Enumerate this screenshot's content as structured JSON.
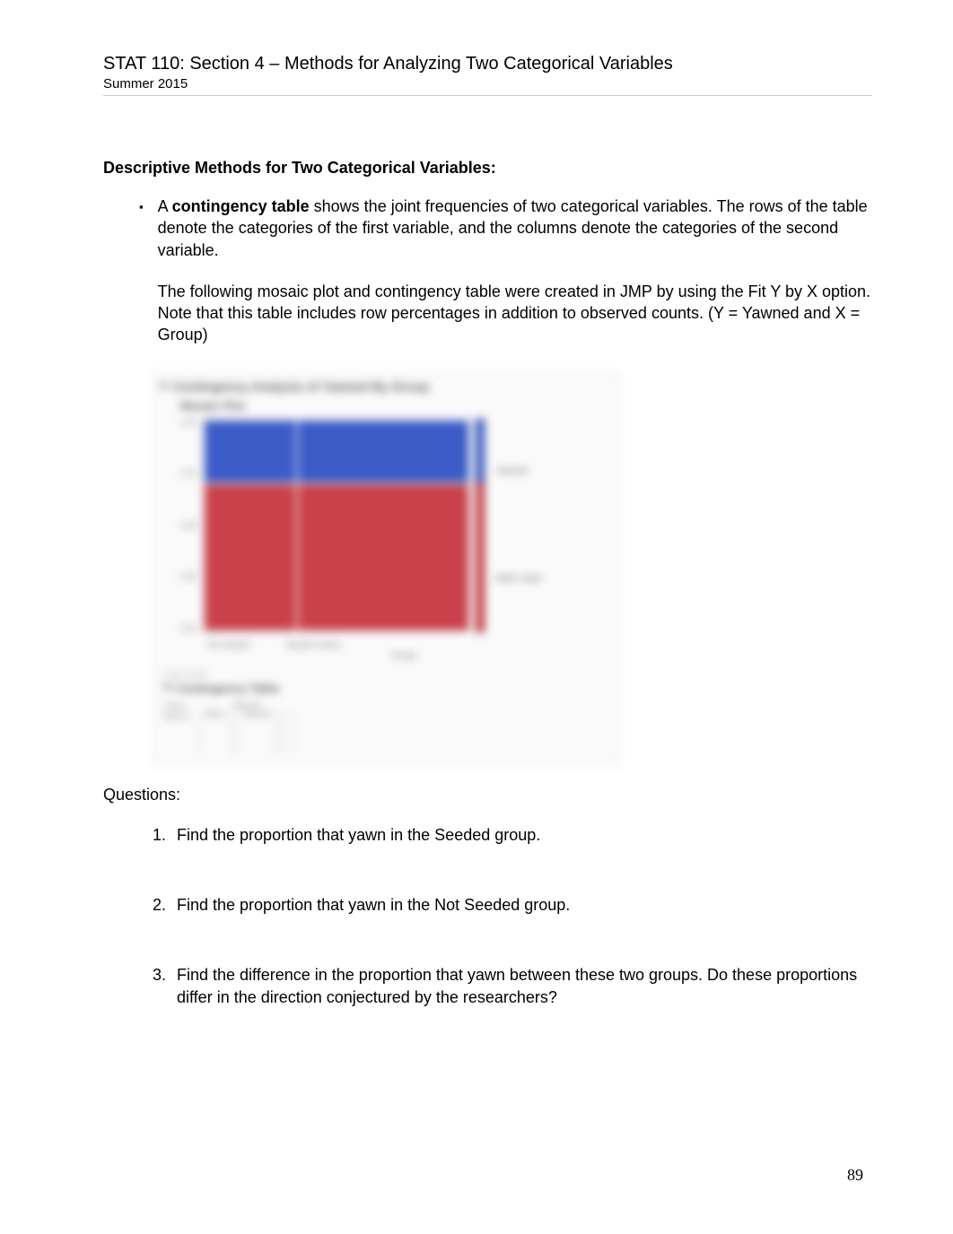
{
  "header": {
    "title": "STAT 110:  Section 4 – Methods for Analyzing Two Categorical Variables",
    "subtitle": "Summer 2015"
  },
  "section_heading": "Descriptive Methods for Two Categorical Variables:",
  "bullet": {
    "para1_a": "A ",
    "para1_b": "contingency table",
    "para1_c": " shows the joint frequencies of two categorical variables.  The rows of the table denote the categories of the first variable, and the columns denote the categories of the second variable.",
    "para2": "The following mosaic plot and contingency table were created in JMP by using the Fit Y by X option.  Note that this table includes row percentages in addition to observed counts.  (Y  = Yawned and X = Group)"
  },
  "figure": {
    "main_title": "Contingency Analysis of Yawned By Group",
    "sub_title": "Mosaic Plot",
    "y_ticks": [
      "1.00",
      "0.75",
      "0.50",
      "0.25",
      "0.00"
    ],
    "x_labels": [
      "Not Seeded",
      "Seeded (Yawn)"
    ],
    "x_axis": "Group",
    "legend": [
      "Yawned",
      "Didn't Yawn"
    ],
    "ct_faint": "Freq: Count",
    "ct_title": "Contingency Table",
    "ct_left_heads": [
      "Count",
      "Row %"
    ],
    "ct_col_head": "Yawned",
    "ct_cols": [
      "Didn't",
      "Yawned"
    ]
  },
  "chart_data": {
    "type": "bar",
    "title": "Mosaic Plot: Yawned by Group",
    "x_variable": "Group",
    "y_variable": "Yawned",
    "groups": [
      {
        "name": "Not Seeded",
        "width_share": 0.35,
        "yawned_share": 0.3,
        "didnt_share": 0.7
      },
      {
        "name": "Seeded",
        "width_share": 0.65,
        "yawned_share": 0.3,
        "didnt_share": 0.7
      }
    ],
    "overall_bar": {
      "yawned_share": 0.3,
      "didnt_share": 0.7
    },
    "y_range": [
      0,
      1
    ],
    "colors": {
      "Yawned": "#3b5bc7",
      "Didn't Yawn": "#c9414a"
    }
  },
  "questions_label": "Questions:",
  "questions": [
    "Find the proportion that yawn in the Seeded group.",
    "Find the proportion that yawn in the Not Seeded group.",
    "Find the difference in the proportion that yawn between these two groups.  Do these proportions differ in the direction conjectured by the researchers?"
  ],
  "page_number": "89"
}
